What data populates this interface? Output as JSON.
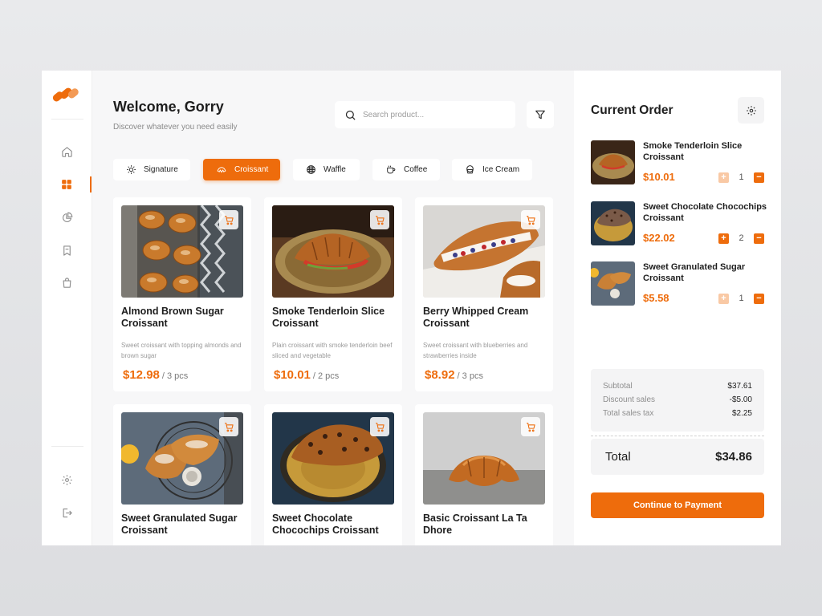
{
  "header": {
    "welcome": "Welcome, Gorry",
    "subtitle": "Discover whatever you need easily",
    "search_placeholder": "Search product..."
  },
  "sidebar": {
    "items": [
      {
        "name": "home-icon",
        "active": false
      },
      {
        "name": "grid-icon",
        "active": true
      },
      {
        "name": "chart-icon",
        "active": false
      },
      {
        "name": "bookmark-icon",
        "active": false
      },
      {
        "name": "bag-icon",
        "active": false
      }
    ],
    "bottom": [
      {
        "name": "gear-icon"
      },
      {
        "name": "logout-icon"
      }
    ]
  },
  "categories": [
    {
      "label": "Signature",
      "icon": "signature-icon",
      "active": false
    },
    {
      "label": "Croissant",
      "icon": "croissant-icon",
      "active": true
    },
    {
      "label": "Waffle",
      "icon": "waffle-icon",
      "active": false
    },
    {
      "label": "Coffee",
      "icon": "coffee-icon",
      "active": false
    },
    {
      "label": "Ice Cream",
      "icon": "ice-cream-icon",
      "active": false
    }
  ],
  "products": [
    {
      "name": "Almond Brown Sugar Croissant",
      "desc": "Sweet croissant with  topping almonds and brown sugar",
      "price": "$12.98",
      "qty": "/ 3 pcs"
    },
    {
      "name": "Smoke Tenderloin Slice Croissant",
      "desc": "Plain croissant with smoke tenderloin beef sliced and vegetable",
      "price": "$10.01",
      "qty": "/ 2 pcs"
    },
    {
      "name": "Berry Whipped Cream Croissant",
      "desc": "Sweet croissant with blueberries and strawberries inside",
      "price": "$8.92",
      "qty": "/ 3 pcs"
    },
    {
      "name": "Sweet Granulated Sugar Croissant",
      "desc": "",
      "price": "",
      "qty": ""
    },
    {
      "name": "Sweet Chocolate Chocochips Croissant",
      "desc": "",
      "price": "",
      "qty": ""
    },
    {
      "name": "Basic Croissant La Ta Dhore",
      "desc": "",
      "price": "",
      "qty": ""
    }
  ],
  "order": {
    "title": "Current Order",
    "items": [
      {
        "name": "Smoke Tenderloin Slice Croissant",
        "price": "$10.01",
        "count": "1",
        "plus_strong": false
      },
      {
        "name": "Sweet Chocolate Chocochips Croissant",
        "price": "$22.02",
        "count": "2",
        "plus_strong": true
      },
      {
        "name": "Sweet Granulated Sugar Croissant",
        "price": "$5.58",
        "count": "1",
        "plus_strong": false
      }
    ],
    "summary": {
      "subtotal_label": "Subtotal",
      "subtotal": "$37.61",
      "discount_label": "Discount sales",
      "discount": "-$5.00",
      "tax_label": "Total sales tax",
      "tax": "$2.25"
    },
    "total_label": "Total",
    "total": "$34.86",
    "pay_label": "Continue to Payment"
  },
  "colors": {
    "accent": "#ee6c0c",
    "accent_light": "#f9c9a5",
    "panel_bg": "#f7f7f8"
  }
}
